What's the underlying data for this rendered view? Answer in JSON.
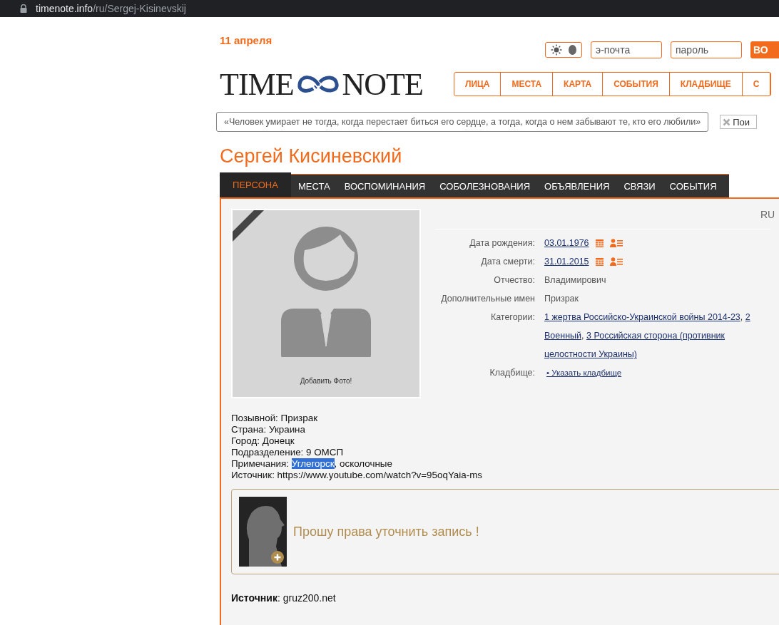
{
  "browser": {
    "host": "timenote.info",
    "path": "/ru/Sergej-Kisinevskij"
  },
  "header": {
    "date": "11 апреля",
    "dark_theme": false,
    "logo_left": "TIME",
    "logo_right": "NOTE",
    "email_placeholder": "э-почта",
    "password_placeholder": "пароль",
    "login_button": "ВО"
  },
  "nav": [
    "ЛИЦА",
    "МЕСТА",
    "КАРТА",
    "СОБЫТИЯ",
    "КЛАДБИЩЕ",
    "С"
  ],
  "quote": "«Человек умирает не тогда, когда перестает биться его сердце, а тогда, когда о нем забывают те, кто его любили»",
  "search": {
    "placeholder": "Пои"
  },
  "person": {
    "name": "Сергей Кисиневский"
  },
  "tabs": [
    {
      "label": "ПЕРСОНА",
      "selected": true
    },
    {
      "label": "МЕСТА",
      "selected": false
    },
    {
      "label": "ВОСПОМИНАНИЯ",
      "selected": false
    },
    {
      "label": "СОБОЛЕЗНОВАНИЯ",
      "selected": false
    },
    {
      "label": "ОБЪЯВЛЕНИЯ",
      "selected": false
    },
    {
      "label": "СВЯЗИ",
      "selected": false
    },
    {
      "label": "СОБЫТИЯ",
      "selected": false
    }
  ],
  "language": "RU",
  "photo": {
    "caption": "Добавить Фото!"
  },
  "facts": [
    {
      "label": "Дата рождения:",
      "kind": "date",
      "value": "03.01.1976"
    },
    {
      "label": "Дата смерти:",
      "kind": "date",
      "value": "31.01.2015"
    },
    {
      "label": "Отчество:",
      "kind": "text",
      "value": "Владимирович"
    },
    {
      "label": "Дополнительные имен",
      "kind": "text",
      "value": "Призрак"
    },
    {
      "label": "Категории:",
      "kind": "links",
      "links": [
        {
          "text": "1 жертва Российско-Украинской войны 2014-23",
          "suffix": ","
        },
        {
          "text": "2 Военный",
          "suffix": ","
        },
        {
          "text": "3 Российская сторона (противник целостности Украины)"
        }
      ]
    },
    {
      "label": "Кладбище:",
      "kind": "link",
      "value": "• Указать кладбище"
    }
  ],
  "details": [
    {
      "parts": [
        {
          "text": "Позывной: Призрак",
          "highlighted": false
        }
      ]
    },
    {
      "parts": [
        {
          "text": "Страна: Украина",
          "highlighted": false
        }
      ]
    },
    {
      "parts": [
        {
          "text": "Город: Донецк",
          "highlighted": false
        }
      ]
    },
    {
      "parts": [
        {
          "text": "Подразделение: 9 ОМСП",
          "highlighted": false
        }
      ]
    },
    {
      "parts": [
        {
          "text": "Примечания: ",
          "highlighted": false
        },
        {
          "text": "Углегорск",
          "highlighted": true
        },
        {
          "text": ", осколочные",
          "highlighted": false
        }
      ]
    },
    {
      "parts": [
        {
          "text": "Источник: https://www.youtube.com/watch?v=95oqYaia-ms",
          "highlighted": false
        }
      ]
    }
  ],
  "request": {
    "text": "Прошу права уточнить запись !"
  },
  "source": "**Источник**: gruz200.net"
}
